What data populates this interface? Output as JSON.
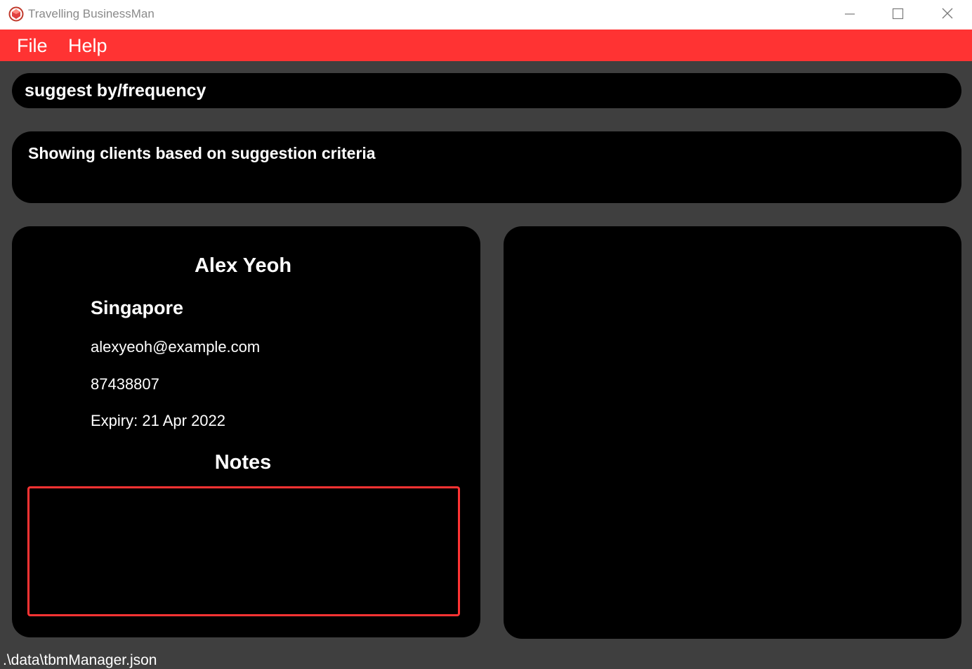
{
  "window": {
    "title": "Travelling BusinessMan",
    "icon": "app-logo-icon"
  },
  "menubar": {
    "file_label": "File",
    "help_label": "Help"
  },
  "command": {
    "value": "suggest by/frequency"
  },
  "result": {
    "message": "Showing clients based on suggestion criteria"
  },
  "client": {
    "name": "Alex Yeoh",
    "location": "Singapore",
    "email": "alexyeoh@example.com",
    "phone": "87438807",
    "expiry": "Expiry: 21 Apr 2022",
    "notes_title": "Notes",
    "notes_value": ""
  },
  "status": {
    "file_path": ".\\data\\tbmManager.json"
  },
  "colors": {
    "accent": "#ff3333",
    "background": "#3f3f3f",
    "panel": "#000000",
    "text": "#ffffff"
  }
}
